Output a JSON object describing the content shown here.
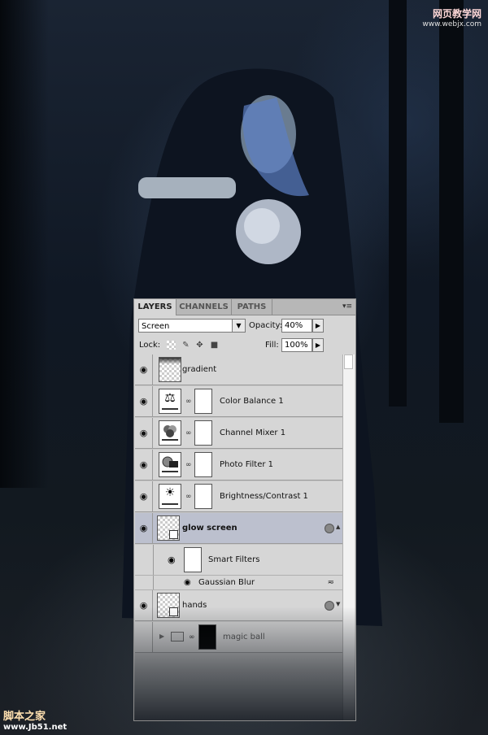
{
  "watermark_top": "网页教学网",
  "watermark_top_url": "www.webjx.com",
  "watermark_bottom": "脚本之家",
  "watermark_bottom_url": "www.Jb51.net",
  "panel": {
    "tabs": [
      {
        "label": "LAYERS",
        "active": true
      },
      {
        "label": "CHANNELS",
        "active": false
      },
      {
        "label": "PATHS",
        "active": false
      }
    ],
    "menu_icon": "panel-menu-icon",
    "blend_mode": "Screen",
    "opacity_label": "Opacity:",
    "opacity_value": "40%",
    "lock_label": "Lock:",
    "fill_label": "Fill:",
    "fill_value": "100%",
    "layers": [
      {
        "name": "gradient",
        "type": "raster"
      },
      {
        "name": "Color Balance 1",
        "type": "adjustment",
        "icon": "color-balance-icon"
      },
      {
        "name": "Channel Mixer 1",
        "type": "adjustment",
        "icon": "channel-mixer-icon"
      },
      {
        "name": "Photo Filter 1",
        "type": "adjustment",
        "icon": "photo-filter-icon"
      },
      {
        "name": "Brightness/Contrast 1",
        "type": "adjustment",
        "icon": "brightness-contrast-icon"
      },
      {
        "name": "glow screen",
        "type": "smart-object",
        "selected": true
      },
      {
        "name": "Smart Filters",
        "type": "smart-filters"
      },
      {
        "name": "Gaussian Blur",
        "type": "filter"
      },
      {
        "name": "hands",
        "type": "smart-object"
      },
      {
        "name": "magic ball",
        "type": "group"
      }
    ]
  },
  "colors": {
    "panel_bg": "#d6d6d6",
    "selected_row": "#bcc0ce",
    "background": "#0c1119"
  }
}
